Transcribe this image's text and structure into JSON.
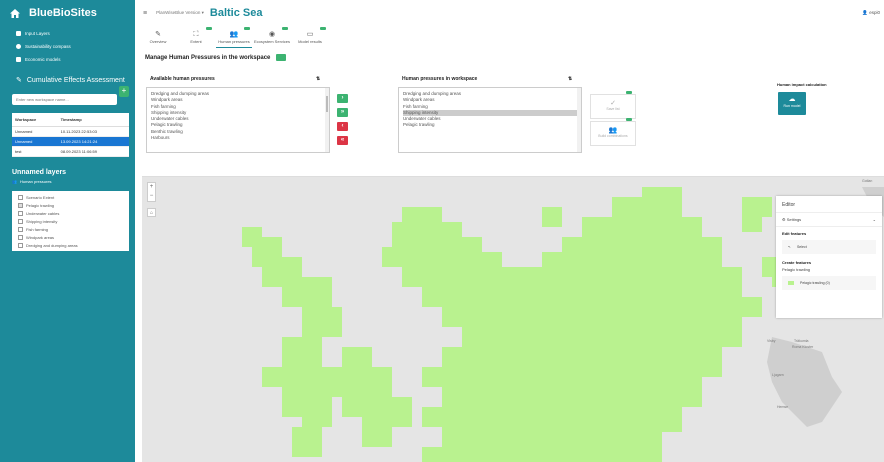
{
  "app": {
    "title": "BlueBioSites"
  },
  "sidebar": {
    "nav": [
      {
        "label": "Input Layers",
        "icon": "layers-icon"
      },
      {
        "label": "Sustainability compass",
        "icon": "compass-icon"
      },
      {
        "label": "Economic models",
        "icon": "chart-icon"
      }
    ],
    "section_title": "Cumulative Effects Assessment",
    "new_workspace_placeholder": "Enter new workspace name...",
    "add_label": "+",
    "table": {
      "headers": [
        "Workspace",
        "Timestamp"
      ],
      "rows": [
        {
          "name": "Unnamed",
          "ts": "10.11.2023 22:53:03",
          "selected": false
        },
        {
          "name": "Unnamed",
          "ts": "13.09.2023 14:21:24",
          "selected": true
        },
        {
          "name": "test",
          "ts": "08.09.2023 11:06:59",
          "selected": false
        }
      ]
    },
    "layers_title": "Unnamed layers",
    "layers_sub": "Human pressures",
    "layers": [
      {
        "label": "Scenario Extent",
        "checked": false
      },
      {
        "label": "Pelagic trawling",
        "checked": true
      },
      {
        "label": "Underwater cables",
        "checked": false
      },
      {
        "label": "Shipping intensity",
        "checked": false
      },
      {
        "label": "Fish farming",
        "checked": false
      },
      {
        "label": "Windpark areas",
        "checked": false
      },
      {
        "label": "Dredging and dumping areas",
        "checked": false
      }
    ]
  },
  "topbar": {
    "breadcrumb": "PlanWiseBlue Version ▾",
    "sea": "Baltic Sea",
    "user": "espi0"
  },
  "tabs": [
    {
      "label": "Overview",
      "icon": "edit-icon",
      "badge": ""
    },
    {
      "label": "Extent",
      "icon": "extent-icon",
      "badge": ""
    },
    {
      "label": "Human pressures",
      "icon": "people-icon",
      "badge": ""
    },
    {
      "label": "Ecosystem Services",
      "icon": "eye-icon",
      "badge": ""
    },
    {
      "label": "Model results",
      "icon": "monitor-icon",
      "badge": ""
    }
  ],
  "manage": {
    "title": "Manage Human Pressures in the workspace",
    "available_title": "Available human pressures",
    "available": [
      "Dredging and dumping areas",
      "Windpark areas",
      "Fish farming",
      "Shipping intensity",
      "Underwater cables",
      "Pelagic trawling",
      "Benthic trawling",
      "Harbours"
    ],
    "workspace_title": "Human pressures in workspace",
    "workspace": [
      "Dredging and dumping areas",
      "Windpark areas",
      "Fish farming",
      "Shipping intensity",
      "Underwater cables",
      "Pelagic trawling"
    ],
    "workspace_selected": "Shipping intensity",
    "save_label": "Save list",
    "build_label": "Build combinations",
    "impact_title": "Human impact calculation",
    "run_label": "Run model"
  },
  "map": {
    "labels": [
      "Gotlan",
      "Visby",
      "Träkumla",
      "Roma Kloster",
      "Ljugarn",
      "Hemse"
    ]
  },
  "editor": {
    "title": "Editor",
    "settings": "Settings",
    "edit_features": "Edit features",
    "select": "Select",
    "create_features": "Create features",
    "layer": "Pelagic trawling",
    "feature_item": "Pelagic trawling (0)"
  },
  "colors": {
    "sidebar": "#1d8a9a",
    "fill": "#b9f28f",
    "accent": "#3cb371",
    "danger": "#dc3545"
  }
}
